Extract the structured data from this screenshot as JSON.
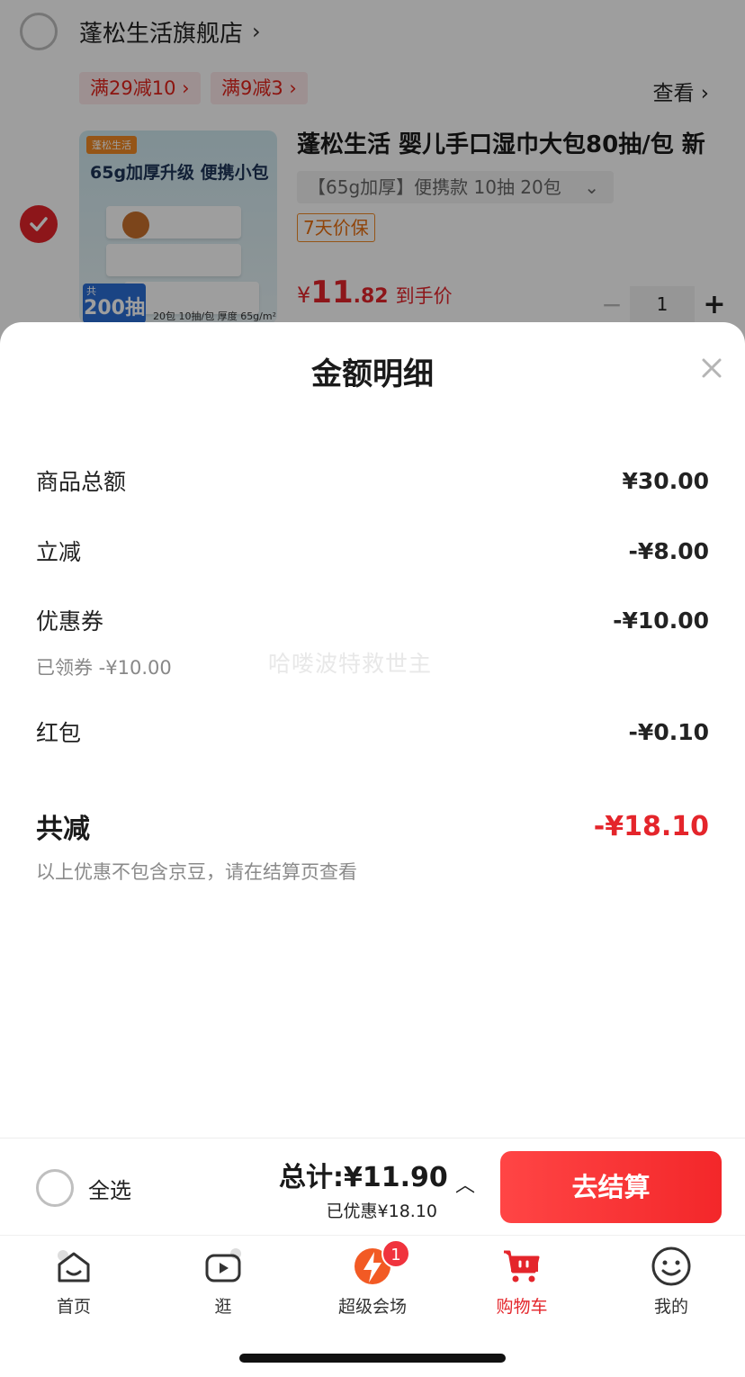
{
  "store": {
    "name": "蓬松生活旗舰店",
    "chevron": "›"
  },
  "promos": [
    "满29减10 ›",
    "满9减3 ›"
  ],
  "view_more": "查看 ›",
  "product": {
    "image_brand": "蓬松生活",
    "image_headline": "65g加厚升级 便携小包",
    "image_count_small": "共",
    "image_count_big": "200抽",
    "image_spec": "20包  10抽/包  厚度 65g/m²",
    "title": "蓬松生活 婴儿手口湿巾大包80抽/包 新",
    "spec": "【65g加厚】便携款 10抽 20包",
    "spec_dropdown": "⌄",
    "tag": "7天价保",
    "price_currency": "¥",
    "price_int": "11",
    "price_dec": ".82",
    "price_label": "到手价",
    "qty_minus": "−",
    "qty": "1",
    "qty_plus": "+"
  },
  "sheet": {
    "title": "金额明细",
    "rows": [
      {
        "label": "商品总额",
        "amount": "¥30.00"
      },
      {
        "label": "立减",
        "amount": "-¥8.00"
      },
      {
        "label": "优惠券",
        "amount": "-¥10.00",
        "sub": "已领券 -¥10.00"
      },
      {
        "label": "红包",
        "amount": "-¥0.10"
      }
    ],
    "watermark": "哈喽波特救世主",
    "total_label": "共减",
    "total_amount": "-¥18.10",
    "note": "以上优惠不包含京豆，请在结算页查看"
  },
  "checkout": {
    "select_all": "全选",
    "total": "总计:¥11.90",
    "saved": "已优惠¥18.10",
    "caret": "︿",
    "pay": "去结算"
  },
  "tabs": [
    {
      "label": "首页",
      "icon": "home-icon"
    },
    {
      "label": "逛",
      "icon": "video-icon"
    },
    {
      "label": "超级会场",
      "icon": "lightning-icon",
      "badge": "1"
    },
    {
      "label": "购物车",
      "icon": "cart-icon",
      "active": true
    },
    {
      "label": "我的",
      "icon": "smile-icon"
    }
  ],
  "colors": {
    "accent": "#e4252b",
    "overlay": "rgba(0,0,0,0.38)"
  }
}
